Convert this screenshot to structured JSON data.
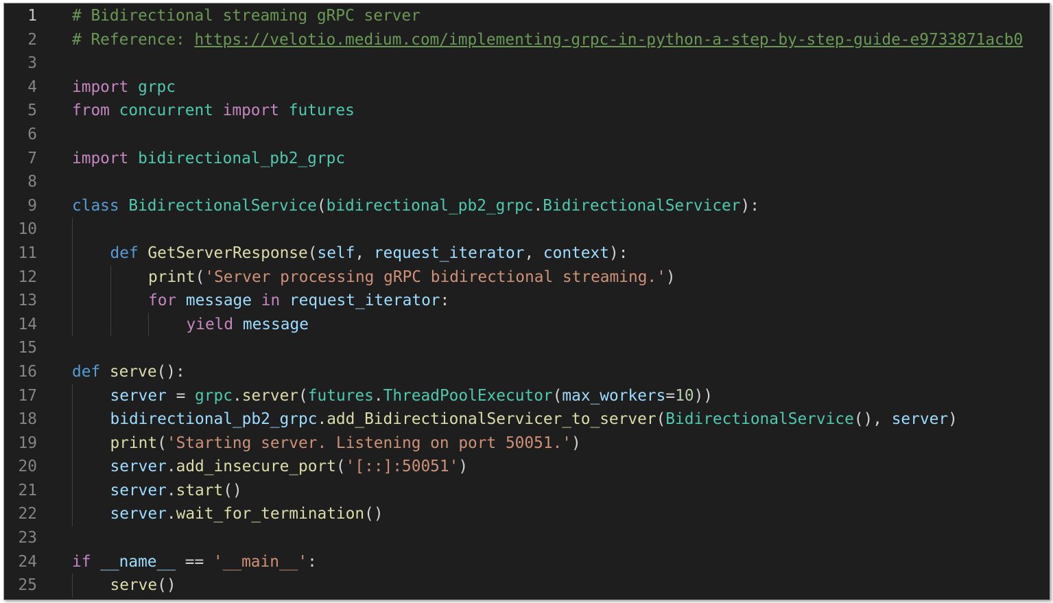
{
  "editor": {
    "language": "python",
    "active_line": 1,
    "colors": {
      "background": "#1e1e1e",
      "line_number": "#858585",
      "active_line_number": "#c6c6c6",
      "comment": "#6a9955",
      "keyword_control": "#c586c0",
      "keyword": "#569cd6",
      "class_name": "#4ec9b0",
      "function": "#dcdcaa",
      "variable": "#9cdcfe",
      "string": "#ce9178",
      "number": "#b5cea8",
      "plain": "#d4d4d4"
    },
    "lines": [
      {
        "n": "1",
        "indent": 0,
        "tokens": [
          [
            "# Bidirectional streaming gRPC server",
            "comment"
          ]
        ]
      },
      {
        "n": "2",
        "indent": 0,
        "tokens": [
          [
            "# Reference: ",
            "comment"
          ],
          [
            "https://velotio.medium.com/implementing-grpc-in-python-a-step-by-step-guide-e9733871acb0",
            "link"
          ]
        ]
      },
      {
        "n": "3",
        "indent": 0,
        "tokens": []
      },
      {
        "n": "4",
        "indent": 0,
        "tokens": [
          [
            "import",
            "keyword_control"
          ],
          [
            " ",
            "plain"
          ],
          [
            "grpc",
            "class_name"
          ]
        ]
      },
      {
        "n": "5",
        "indent": 0,
        "tokens": [
          [
            "from",
            "keyword_control"
          ],
          [
            " ",
            "plain"
          ],
          [
            "concurrent",
            "class_name"
          ],
          [
            " ",
            "plain"
          ],
          [
            "import",
            "keyword_control"
          ],
          [
            " ",
            "plain"
          ],
          [
            "futures",
            "class_name"
          ]
        ]
      },
      {
        "n": "6",
        "indent": 0,
        "tokens": []
      },
      {
        "n": "7",
        "indent": 0,
        "tokens": [
          [
            "import",
            "keyword_control"
          ],
          [
            " ",
            "plain"
          ],
          [
            "bidirectional_pb2_grpc",
            "class_name"
          ]
        ]
      },
      {
        "n": "8",
        "indent": 0,
        "tokens": []
      },
      {
        "n": "9",
        "indent": 0,
        "tokens": [
          [
            "class",
            "keyword"
          ],
          [
            " ",
            "plain"
          ],
          [
            "BidirectionalService",
            "class_name"
          ],
          [
            "(",
            "plain"
          ],
          [
            "bidirectional_pb2_grpc",
            "class_name"
          ],
          [
            ".",
            "plain"
          ],
          [
            "BidirectionalServicer",
            "class_name"
          ],
          [
            "):",
            "plain"
          ]
        ]
      },
      {
        "n": "10",
        "indent": 0,
        "guides": 1,
        "tokens": []
      },
      {
        "n": "11",
        "indent": 1,
        "tokens": [
          [
            "def",
            "keyword"
          ],
          [
            " ",
            "plain"
          ],
          [
            "GetServerResponse",
            "function"
          ],
          [
            "(",
            "plain"
          ],
          [
            "self",
            "variable"
          ],
          [
            ", ",
            "plain"
          ],
          [
            "request_iterator",
            "variable"
          ],
          [
            ", ",
            "plain"
          ],
          [
            "context",
            "variable"
          ],
          [
            "):",
            "plain"
          ]
        ]
      },
      {
        "n": "12",
        "indent": 2,
        "tokens": [
          [
            "print",
            "function"
          ],
          [
            "(",
            "plain"
          ],
          [
            "'Server processing gRPC bidirectional streaming.'",
            "string"
          ],
          [
            ")",
            "plain"
          ]
        ]
      },
      {
        "n": "13",
        "indent": 2,
        "tokens": [
          [
            "for",
            "keyword_control"
          ],
          [
            " ",
            "plain"
          ],
          [
            "message",
            "variable"
          ],
          [
            " ",
            "plain"
          ],
          [
            "in",
            "keyword_control"
          ],
          [
            " ",
            "plain"
          ],
          [
            "request_iterator",
            "variable"
          ],
          [
            ":",
            "plain"
          ]
        ]
      },
      {
        "n": "14",
        "indent": 3,
        "tokens": [
          [
            "yield",
            "keyword_control"
          ],
          [
            " ",
            "plain"
          ],
          [
            "message",
            "variable"
          ]
        ]
      },
      {
        "n": "15",
        "indent": 0,
        "tokens": []
      },
      {
        "n": "16",
        "indent": 0,
        "tokens": [
          [
            "def",
            "keyword"
          ],
          [
            " ",
            "plain"
          ],
          [
            "serve",
            "function"
          ],
          [
            "():",
            "plain"
          ]
        ]
      },
      {
        "n": "17",
        "indent": 1,
        "tokens": [
          [
            "server",
            "variable"
          ],
          [
            " = ",
            "plain"
          ],
          [
            "grpc",
            "class_name"
          ],
          [
            ".",
            "plain"
          ],
          [
            "server",
            "function"
          ],
          [
            "(",
            "plain"
          ],
          [
            "futures",
            "class_name"
          ],
          [
            ".",
            "plain"
          ],
          [
            "ThreadPoolExecutor",
            "class_name"
          ],
          [
            "(",
            "plain"
          ],
          [
            "max_workers",
            "variable"
          ],
          [
            "=",
            "plain"
          ],
          [
            "10",
            "number"
          ],
          [
            "))",
            "plain"
          ]
        ]
      },
      {
        "n": "18",
        "indent": 1,
        "tokens": [
          [
            "bidirectional_pb2_grpc",
            "variable"
          ],
          [
            ".",
            "plain"
          ],
          [
            "add_BidirectionalServicer_to_server",
            "function"
          ],
          [
            "(",
            "plain"
          ],
          [
            "BidirectionalService",
            "class_name"
          ],
          [
            "(), ",
            "plain"
          ],
          [
            "server",
            "variable"
          ],
          [
            ")",
            "plain"
          ]
        ]
      },
      {
        "n": "19",
        "indent": 1,
        "tokens": [
          [
            "print",
            "function"
          ],
          [
            "(",
            "plain"
          ],
          [
            "'Starting server. Listening on port 50051.'",
            "string"
          ],
          [
            ")",
            "plain"
          ]
        ]
      },
      {
        "n": "20",
        "indent": 1,
        "tokens": [
          [
            "server",
            "variable"
          ],
          [
            ".",
            "plain"
          ],
          [
            "add_insecure_port",
            "function"
          ],
          [
            "(",
            "plain"
          ],
          [
            "'[::]:50051'",
            "string"
          ],
          [
            ")",
            "plain"
          ]
        ]
      },
      {
        "n": "21",
        "indent": 1,
        "tokens": [
          [
            "server",
            "variable"
          ],
          [
            ".",
            "plain"
          ],
          [
            "start",
            "function"
          ],
          [
            "()",
            "plain"
          ]
        ]
      },
      {
        "n": "22",
        "indent": 1,
        "tokens": [
          [
            "server",
            "variable"
          ],
          [
            ".",
            "plain"
          ],
          [
            "wait_for_termination",
            "function"
          ],
          [
            "()",
            "plain"
          ]
        ]
      },
      {
        "n": "23",
        "indent": 0,
        "tokens": []
      },
      {
        "n": "24",
        "indent": 0,
        "tokens": [
          [
            "if",
            "keyword_control"
          ],
          [
            " ",
            "plain"
          ],
          [
            "__name__",
            "variable"
          ],
          [
            " == ",
            "plain"
          ],
          [
            "'__main__'",
            "string"
          ],
          [
            ":",
            "plain"
          ]
        ]
      },
      {
        "n": "25",
        "indent": 1,
        "tokens": [
          [
            "serve",
            "function"
          ],
          [
            "()",
            "plain"
          ]
        ]
      }
    ]
  }
}
